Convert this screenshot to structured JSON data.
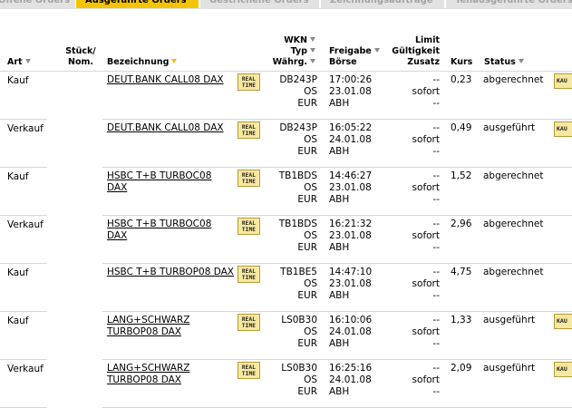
{
  "tabs": [
    {
      "label": "Offene Orders",
      "active": false
    },
    {
      "label": "Ausgeführte Orders",
      "active": true
    },
    {
      "label": "Gestrichene Orders",
      "active": false
    },
    {
      "label": "Zeichnungsaufträge",
      "active": false
    },
    {
      "label": "Teilausgeführte Orders",
      "active": false
    }
  ],
  "headers": {
    "art": "Art",
    "stueck": "Stück/",
    "nom": "Nom.",
    "bezeichnung": "Bezeichnung",
    "wkn": "WKN",
    "typ": "Typ",
    "waehrg": "Währg.",
    "freigabe": "Freigabe",
    "boerse": "Börse",
    "limit": "Limit",
    "gueltigkeit": "Gültigkeit",
    "zusatz": "Zusatz",
    "kurs": "Kurs",
    "status": "Status"
  },
  "realtime_label": [
    "REAL",
    "TIME"
  ],
  "action_label": "KAU",
  "orders": [
    {
      "art": "Kauf",
      "bez1": "DEUT.BANK CALL08 DAX",
      "bez2": "",
      "wkn": "DB243P",
      "typ": "OS",
      "waehrung": "EUR",
      "zeit": "17:00:26",
      "datum": "23.01.08",
      "boerse": "ABH",
      "limit": "--",
      "gueltigkeit": "sofort",
      "zusatz": "--",
      "kurs": "0,23",
      "status": "abgerechnet",
      "kau": true
    },
    {
      "art": "Verkauf",
      "bez1": "DEUT.BANK CALL08 DAX",
      "bez2": "",
      "wkn": "DB243P",
      "typ": "OS",
      "waehrung": "EUR",
      "zeit": "16:05:22",
      "datum": "24.01.08",
      "boerse": "ABH",
      "limit": "--",
      "gueltigkeit": "sofort",
      "zusatz": "--",
      "kurs": "0,49",
      "status": "ausgeführt",
      "kau": true
    },
    {
      "art": "Kauf",
      "bez1": "HSBC T+B TURBOC08",
      "bez2": "DAX",
      "wkn": "TB1BDS",
      "typ": "OS",
      "waehrung": "EUR",
      "zeit": "14:46:27",
      "datum": "23.01.08",
      "boerse": "ABH",
      "limit": "--",
      "gueltigkeit": "sofort",
      "zusatz": "--",
      "kurs": "1,52",
      "status": "abgerechnet",
      "kau": false
    },
    {
      "art": "Verkauf",
      "bez1": "HSBC T+B TURBOC08",
      "bez2": "DAX",
      "wkn": "TB1BDS",
      "typ": "OS",
      "waehrung": "EUR",
      "zeit": "16:21:32",
      "datum": "23.01.08",
      "boerse": "ABH",
      "limit": "--",
      "gueltigkeit": "sofort",
      "zusatz": "--",
      "kurs": "2,96",
      "status": "abgerechnet",
      "kau": false
    },
    {
      "art": "Kauf",
      "bez1": "HSBC T+B TURBOP08 DAX",
      "bez2": "",
      "wkn": "TB1BE5",
      "typ": "OS",
      "waehrung": "EUR",
      "zeit": "14:47:10",
      "datum": "23.01.08",
      "boerse": "ABH",
      "limit": "--",
      "gueltigkeit": "sofort",
      "zusatz": "--",
      "kurs": "4,75",
      "status": "abgerechnet",
      "kau": false
    },
    {
      "art": "Kauf",
      "bez1": "LANG+SCHWARZ",
      "bez2": "TURBOP08 DAX",
      "wkn": "LS0B30",
      "typ": "OS",
      "waehrung": "EUR",
      "zeit": "16:10:06",
      "datum": "24.01.08",
      "boerse": "ABH",
      "limit": "--",
      "gueltigkeit": "sofort",
      "zusatz": "--",
      "kurs": "1,33",
      "status": "ausgeführt",
      "kau": true
    },
    {
      "art": "Verkauf",
      "bez1": "LANG+SCHWARZ",
      "bez2": "TURBOP08 DAX",
      "wkn": "LS0B30",
      "typ": "OS",
      "waehrung": "EUR",
      "zeit": "16:25:16",
      "datum": "24.01.08",
      "boerse": "ABH",
      "limit": "--",
      "gueltigkeit": "sofort",
      "zusatz": "--",
      "kurs": "2,09",
      "status": "ausgeführt",
      "kau": true
    }
  ]
}
